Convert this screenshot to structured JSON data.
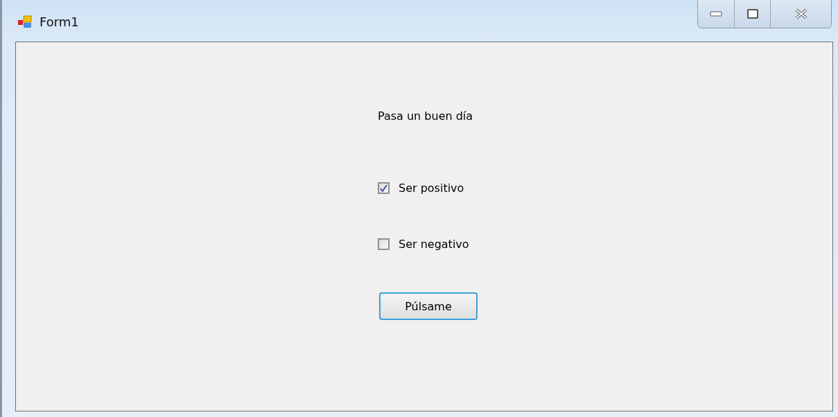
{
  "window": {
    "title": "Form1"
  },
  "label": "Pasa un buen día",
  "checkboxes": [
    {
      "label": "Ser positivo",
      "checked": true
    },
    {
      "label": "Ser negativo",
      "checked": false
    }
  ],
  "button": "Púlsame"
}
